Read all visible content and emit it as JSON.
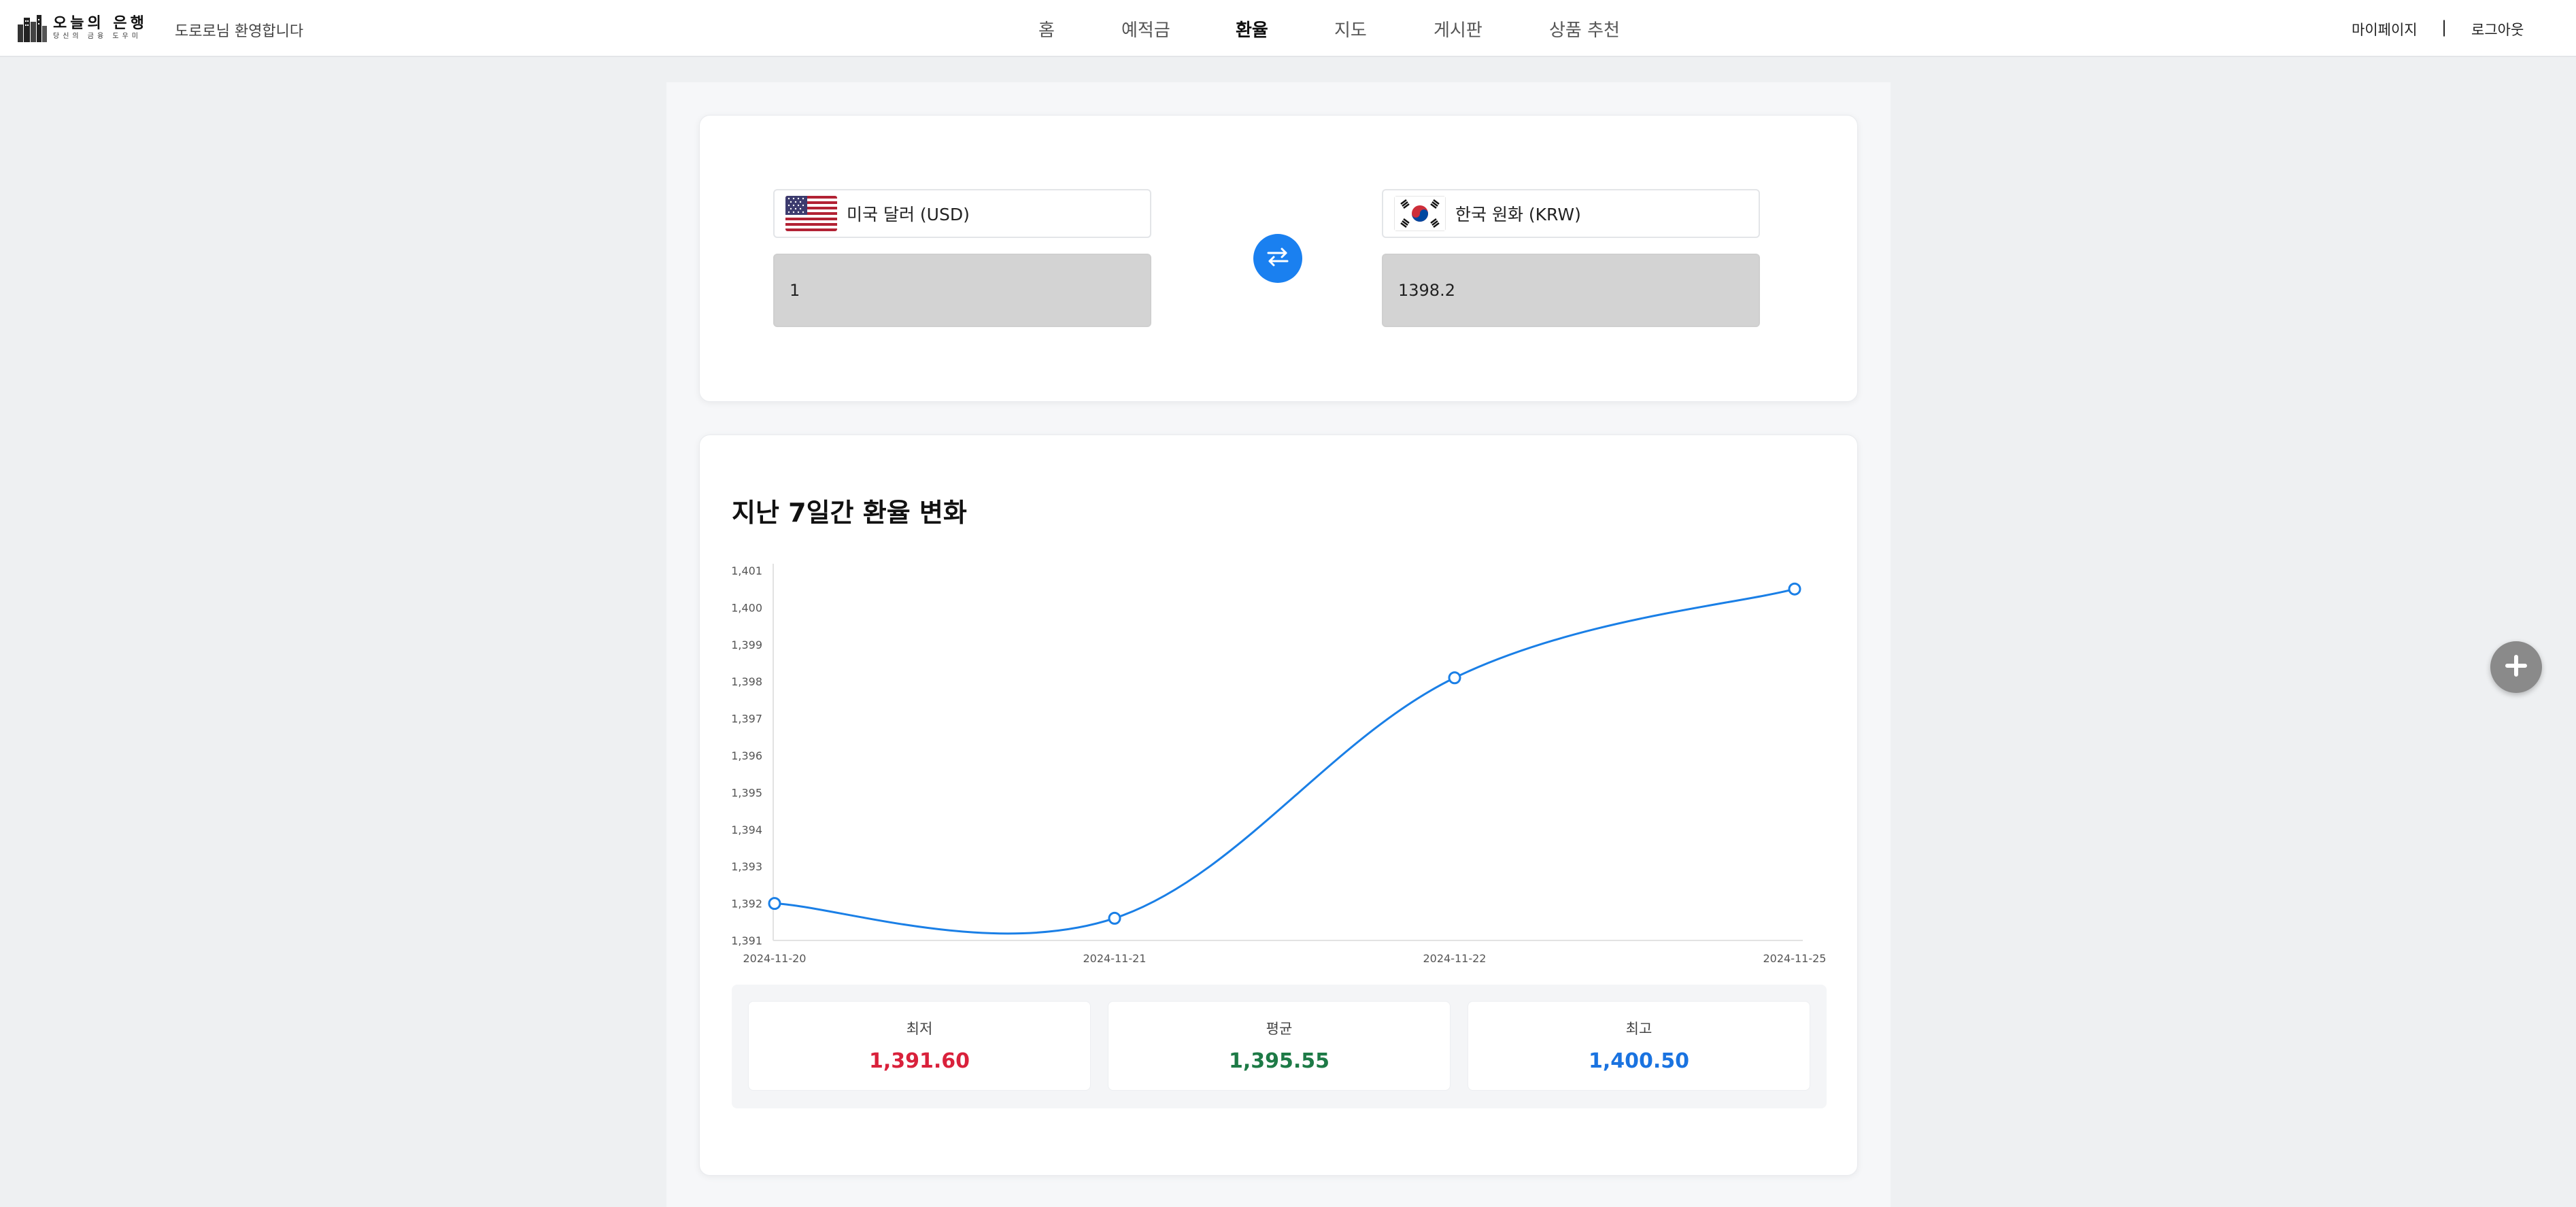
{
  "header": {
    "logo_title": "오늘의 은행",
    "logo_subtitle": "당신의 금융 도우미",
    "welcome": "도로로님 환영합니다",
    "nav": [
      "홈",
      "예적금",
      "환율",
      "지도",
      "게시판",
      "상품 추천"
    ],
    "active_nav": "환율",
    "mypage": "마이페이지",
    "separator": "|",
    "logout": "로그아웃"
  },
  "converter": {
    "from_currency": "미국 달러 (USD)",
    "to_currency": "한국 원화 (KRW)",
    "from_amount": "1",
    "to_amount": "1398.2",
    "from_flag_icon": "us-flag-icon",
    "to_flag_icon": "kr-flag-icon",
    "swap_icon": "swap-arrows-icon"
  },
  "chart_section": {
    "title": "지난 7일간 환율 변화"
  },
  "chart_data": {
    "type": "line",
    "categories": [
      "2024-11-20",
      "2024-11-21",
      "2024-11-22",
      "2024-11-25"
    ],
    "series": [
      {
        "values": [
          1392.0,
          1391.6,
          1398.1,
          1400.5
        ]
      }
    ],
    "ylim": [
      1391,
      1401
    ],
    "yticks": [
      "1,391",
      "1,392",
      "1,393",
      "1,394",
      "1,395",
      "1,396",
      "1,397",
      "1,398",
      "1,399",
      "1,400",
      "1,401"
    ],
    "grid": false,
    "color": "#1a7fe6"
  },
  "stats": {
    "min_label": "최저",
    "min_value": "1,391.60",
    "avg_label": "평균",
    "avg_value": "1,395.55",
    "max_label": "최고",
    "max_value": "1,400.50",
    "min_color": "#d9213b",
    "avg_color": "#1d7a46",
    "max_color": "#1a73e0"
  },
  "fab_icon": "plus-icon"
}
